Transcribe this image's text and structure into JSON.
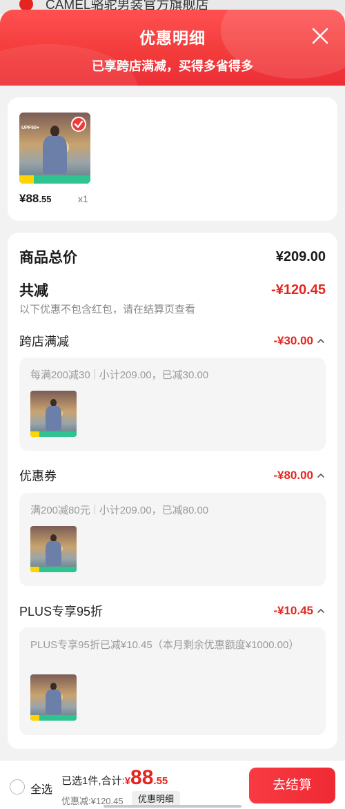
{
  "store": {
    "name": "CAMEL骆驼男装官方旗舰店"
  },
  "header": {
    "title": "优惠明细",
    "subtitle": "已享跨店满减，买得多省得多"
  },
  "product": {
    "image_tags": [
      "UPF50+",
      "179",
      "跨店每满200减30",
      "-99%"
    ],
    "price_int": "¥88",
    "price_dec": ".55",
    "qty": "x1",
    "selected": true
  },
  "summary": {
    "total_label": "商品总价",
    "total_value": "¥209.00",
    "reduce_label": "共减",
    "reduce_value": "-¥120.45",
    "note": "以下优惠不包含红包，请在结算页查看"
  },
  "sections": [
    {
      "label": "跨店满减",
      "value": "-¥30.00",
      "rule": "每满200减30",
      "subtotal": "小计209.00，已减30.00"
    },
    {
      "label": "优惠券",
      "value": "-¥80.00",
      "rule": "满200减80元",
      "subtotal": "小计209.00，已减80.00"
    },
    {
      "label": "PLUS专享95折",
      "value": "-¥10.45",
      "desc": "PLUS专享95折已减¥10.45（本月剩余优惠额度¥1000.00）"
    }
  ],
  "bottom": {
    "select_all": "全选",
    "selected_text": "已选1件,合计:",
    "currency": "¥",
    "total_int": "88",
    "total_dec": ".55",
    "saved": "优惠减:¥120.45",
    "detail_btn": "优惠明细",
    "checkout": "去结算"
  },
  "colors": {
    "accent": "#e4261f",
    "header": "#f23a3a",
    "promo_bar": "#2fc391"
  },
  "icons": [
    "close-icon",
    "check-icon",
    "chevron-up-icon"
  ]
}
